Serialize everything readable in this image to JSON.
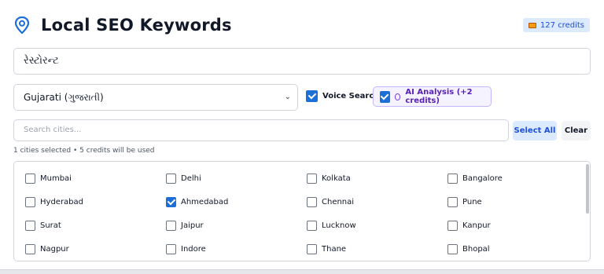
{
  "header": {
    "title": "Local SEO Keywords",
    "icon": "map-pin-icon",
    "credits_label": "127 credits"
  },
  "keyword_input": {
    "value": "રેસ્ટોરન્ટ"
  },
  "language_select": {
    "value": "Gujarati (ગુજરાતી)"
  },
  "options": {
    "voice_search": {
      "label": "Voice Search",
      "checked": true
    },
    "ai_analysis": {
      "label": "AI Analysis (+2 credits)",
      "checked": true
    }
  },
  "city_search": {
    "placeholder": "Search cities...",
    "select_all_label": "Select All",
    "clear_label": "Clear"
  },
  "selection_info": "1 cities selected • 5 credits will be used",
  "cities": [
    {
      "name": "Mumbai",
      "checked": false
    },
    {
      "name": "Delhi",
      "checked": false
    },
    {
      "name": "Kolkata",
      "checked": false
    },
    {
      "name": "Bangalore",
      "checked": false
    },
    {
      "name": "Hyderabad",
      "checked": false
    },
    {
      "name": "Ahmedabad",
      "checked": true
    },
    {
      "name": "Chennai",
      "checked": false
    },
    {
      "name": "Pune",
      "checked": false
    },
    {
      "name": "Surat",
      "checked": false
    },
    {
      "name": "Jaipur",
      "checked": false
    },
    {
      "name": "Lucknow",
      "checked": false
    },
    {
      "name": "Kanpur",
      "checked": false
    },
    {
      "name": "Nagpur",
      "checked": false
    },
    {
      "name": "Indore",
      "checked": false
    },
    {
      "name": "Thane",
      "checked": false
    },
    {
      "name": "Bhopal",
      "checked": false
    }
  ],
  "colors": {
    "accent": "#1d6fd8",
    "ai_accent": "#7c3aed",
    "credits_bg": "#dbeafe"
  }
}
